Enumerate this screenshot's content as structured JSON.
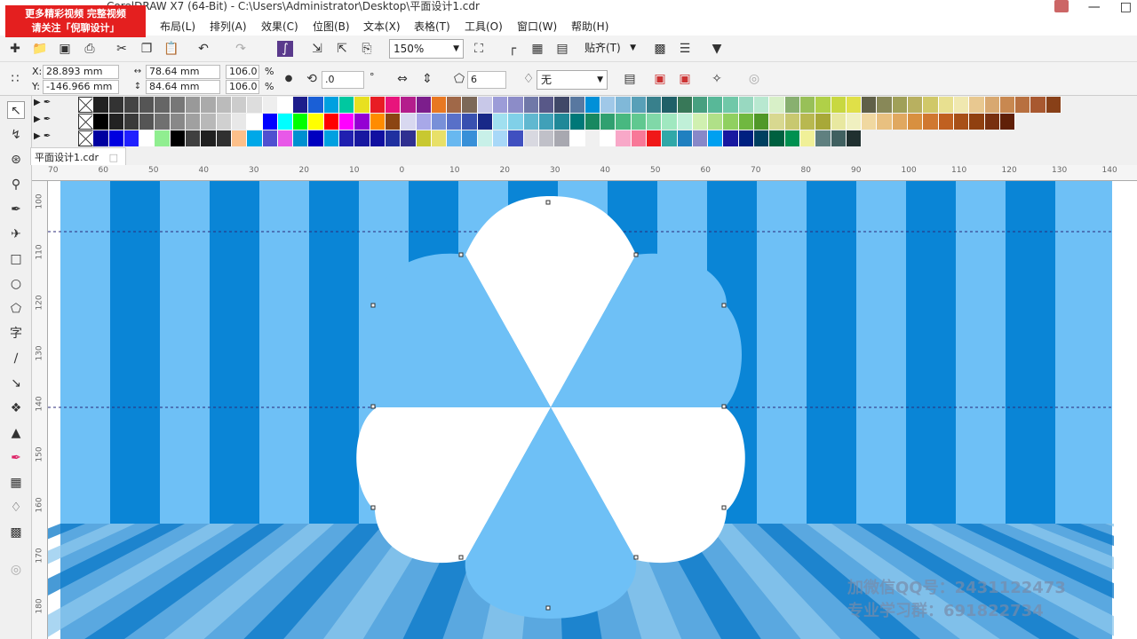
{
  "titlebar": {
    "title": "CorelDRAW X7 (64-Bit) - C:\\Users\\Administrator\\Desktop\\平面设计1.cdr"
  },
  "promo": {
    "line1": "更多精彩视频 完整视频",
    "line2": "请关注「倪聊设计」"
  },
  "menu": [
    "布局(L)",
    "排列(A)",
    "效果(C)",
    "位图(B)",
    "文本(X)",
    "表格(T)",
    "工具(O)",
    "窗口(W)",
    "帮助(H)"
  ],
  "toolbar": {
    "zoom": "150%",
    "snap": "贴齐(T)"
  },
  "props": {
    "x_label": "X:",
    "x": "28.893 mm",
    "y_label": "Y:",
    "y": "-146.966 mm",
    "w": "78.64 mm",
    "h": "84.64 mm",
    "w_pct": "106.0",
    "h_pct": "106.0",
    "pct": "%",
    "rotation": ".0",
    "deg": "°",
    "points": "6",
    "outline": "无"
  },
  "doc_tab": "平面设计1.cdr",
  "ruler_h": [
    "70",
    "60",
    "50",
    "40",
    "30",
    "20",
    "10",
    "0",
    "10",
    "20",
    "30",
    "40",
    "50",
    "60",
    "70",
    "80",
    "90",
    "100",
    "110",
    "120",
    "130",
    "140"
  ],
  "ruler_v": [
    "100",
    "110",
    "120",
    "130",
    "140",
    "150",
    "160",
    "170",
    "180"
  ],
  "watermark": {
    "line1": "加微信QQ号：2431122473",
    "line2": "专业学习群：691822734"
  },
  "colors": {
    "stripe_dark": "#0a85d6",
    "stripe_light": "#6ec0f6",
    "floor": "#5aa8e0"
  },
  "palette": {
    "row1": [
      "#222",
      "#333",
      "#444",
      "#555",
      "#666",
      "#777",
      "#999",
      "#aaa",
      "#bbb",
      "#ccc",
      "#ddd",
      "#eee",
      "#fff",
      "#1d1d8c",
      "#1a5fd6",
      "#00a0e0",
      "#00c8a0",
      "#e8e020",
      "#e81c24",
      "#e8147c",
      "#b41e8c",
      "#7c1e8c",
      "#e87822",
      "#a06848",
      "#7c6858",
      "#c8c8e8",
      "#9c9cd8",
      "#8c8cc8",
      "#7078a8",
      "#585888",
      "#404868",
      "#5878a0",
      "#0090d8",
      "#a0c8e8",
      "#80b8d8",
      "#58a0b8",
      "#38808c",
      "#206068",
      "#387858",
      "#48a080",
      "#58b898",
      "#70c8a8",
      "#98d8c0",
      "#b8e8d0",
      "#d8f0c8",
      "#88b070",
      "#98c058",
      "#b0d048",
      "#c8d840",
      "#e0e048",
      "#606048",
      "#888858",
      "#a0a058",
      "#b8b060",
      "#d0c868",
      "#e8e090",
      "#f0e8b0",
      "#e8c890",
      "#d8a870",
      "#c88850",
      "#b87040",
      "#a85830",
      "#884018"
    ],
    "row2": [
      "#000",
      "#222",
      "#3a3a3a",
      "#555",
      "#707070",
      "#888",
      "#a0a0a0",
      "#b8b8b8",
      "#d0d0d0",
      "#e8e8e8",
      "#fff",
      "#0000ff",
      "#00ffff",
      "#00ff00",
      "#ffff00",
      "#ff0000",
      "#ff00ff",
      "#9400d3",
      "#ff8c00",
      "#8b4513",
      "#d8d8f0",
      "#a8a8e8",
      "#7890d8",
      "#5870c8",
      "#3850b0",
      "#182888",
      "#a0e0f0",
      "#80d0e8",
      "#60b8d0",
      "#40a0b8",
      "#208898",
      "#007878",
      "#188860",
      "#30a070",
      "#48b880",
      "#60c890",
      "#80d8a8",
      "#a0e8c0",
      "#c0f0d8",
      "#d0f0b0",
      "#b0e088",
      "#90d060",
      "#70b840",
      "#509828",
      "#d8d890",
      "#c8c870",
      "#b8b850",
      "#a8a838",
      "#e8e8a0",
      "#f0f0c0",
      "#f0d8a0",
      "#e8c080",
      "#e0a860",
      "#d89040",
      "#d07830",
      "#c06020",
      "#a85018",
      "#904010",
      "#783010",
      "#602008"
    ],
    "row3": [
      "#0000a0",
      "#0000e0",
      "#2020ff",
      "#ffffff",
      "#90ee90",
      "#000000",
      "#404040",
      "#202020",
      "#303030",
      "#fdc08a",
      "#00a8e8",
      "#5050d0",
      "#e858e8",
      "#0090d0",
      "#0000c0",
      "#00a0e0",
      "#2020b0",
      "#1818a0",
      "#1010a0",
      "#2030a0",
      "#303090",
      "#c8c830",
      "#e8e068",
      "#68b8f0",
      "#3890d8",
      "#c8f0e8",
      "#a8d8f8",
      "#4050c0",
      "#d8d8e0",
      "#c0c0c8",
      "#a8a8b0",
      "#ffffff",
      "#f0f0f0",
      "#ffffff",
      "#f8a8c8",
      "#f87898",
      "#f01818",
      "#30a8a8",
      "#2080c0",
      "#8888c8",
      "#00a0f0",
      "#1818a0",
      "#002080",
      "#004060",
      "#006040",
      "#009050",
      "#f0f098",
      "#608080",
      "#406060",
      "#203030"
    ]
  }
}
